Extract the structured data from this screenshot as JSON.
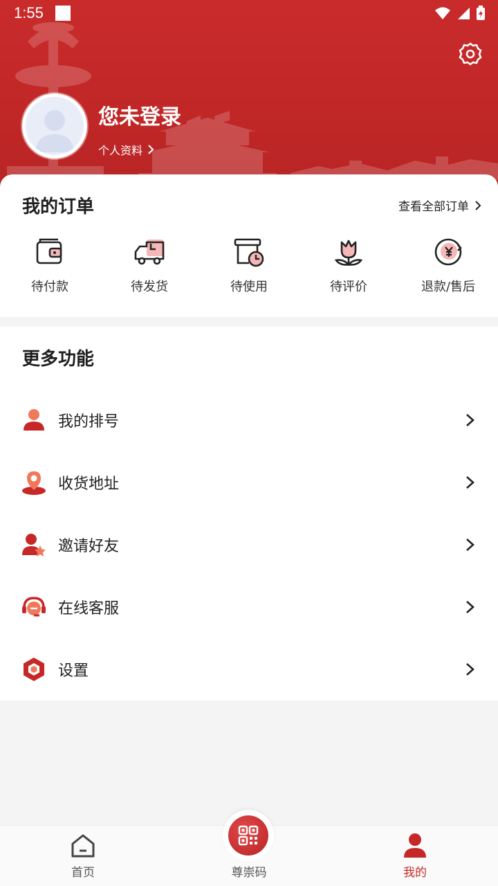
{
  "status_bar": {
    "time": "1:55"
  },
  "profile": {
    "title": "您未登录",
    "link_label": "个人资料"
  },
  "orders": {
    "title": "我的订单",
    "view_all": "查看全部订单",
    "items": [
      {
        "label": "待付款",
        "icon": "wallet-icon"
      },
      {
        "label": "待发货",
        "icon": "delivery-truck-icon"
      },
      {
        "label": "待使用",
        "icon": "box-clock-icon"
      },
      {
        "label": "待评价",
        "icon": "flower-icon"
      },
      {
        "label": "退款/售后",
        "icon": "refund-icon"
      }
    ]
  },
  "more": {
    "title": "更多功能",
    "items": [
      {
        "label": "我的排号",
        "icon": "user-queue-icon"
      },
      {
        "label": "收货地址",
        "icon": "location-pin-icon"
      },
      {
        "label": "邀请好友",
        "icon": "invite-friend-icon"
      },
      {
        "label": "在线客服",
        "icon": "customer-service-icon"
      },
      {
        "label": "设置",
        "icon": "settings-hexagon-icon"
      }
    ]
  },
  "bottom_nav": {
    "home": "首页",
    "qr": "尊崇码",
    "mine": "我的"
  },
  "colors": {
    "brand_red": "#c62828",
    "accent_pink": "#f5b7b7",
    "text_dark": "#222222",
    "nav_inactive": "#555555"
  }
}
